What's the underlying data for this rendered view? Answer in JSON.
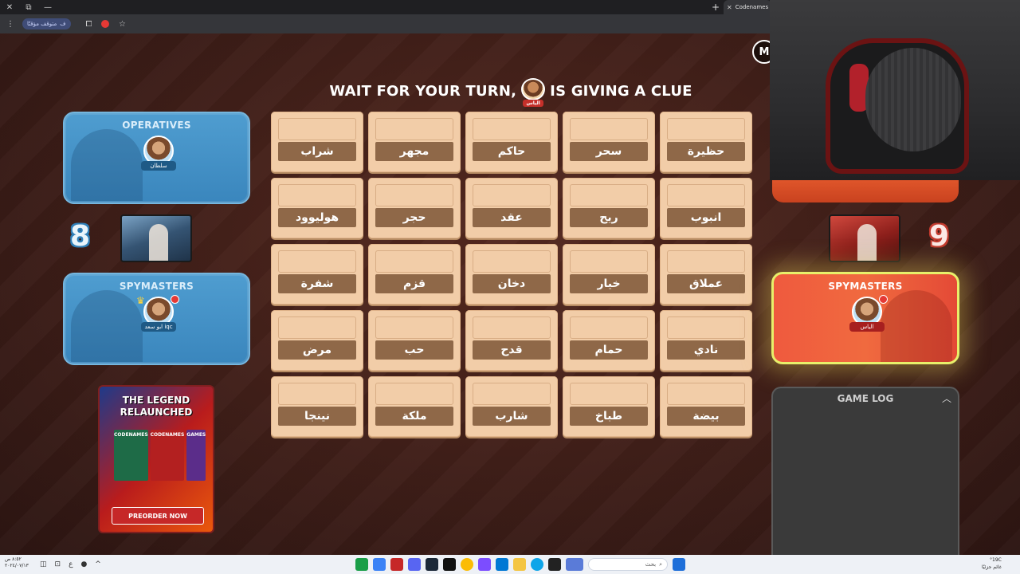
{
  "browser": {
    "tab_title": "Codenames Or",
    "paused_label": "متوقف مؤقتًا",
    "profile_initial": "ف",
    "new_tab_symbol": "+"
  },
  "game": {
    "menu_button_label": "M",
    "headline_before": "WAIT FOR YOUR TURN,",
    "headline_after": "IS GIVING A CLUE",
    "headline_avatar_name": "الياس",
    "blue": {
      "score": "8",
      "operatives_title": "OPERATIVES",
      "operatives_player": "سلطان",
      "spymasters_title": "SPYMASTERS",
      "spymaster_player": "ابو سعد iqc"
    },
    "red": {
      "score": "9",
      "spymasters_title": "SPYMASTERS",
      "spymaster_player": "الياس"
    },
    "game_log_title": "GAME LOG",
    "cards": [
      "شراب",
      "مجهر",
      "حاكم",
      "سحر",
      "حظيرة",
      "هوليوود",
      "حجر",
      "عقد",
      "ريح",
      "انبوب",
      "شفرة",
      "قزم",
      "دخان",
      "خيار",
      "عملاق",
      "مرض",
      "حب",
      "قدح",
      "حمام",
      "نادي",
      "نينجا",
      "ملكة",
      "شارب",
      "طباخ",
      "بيضة"
    ],
    "ad": {
      "title_line1": "THE LEGEND",
      "title_line2": "RELAUNCHED",
      "box_labels": [
        "CODENAMES",
        "CODENAMES",
        "GAMES"
      ],
      "button_label": "PREORDER NOW"
    }
  },
  "taskbar": {
    "search_placeholder": "بحث",
    "clock_time": "٨:٥٢ ص",
    "clock_date": "٢٠٢٤/٠٧/١٣",
    "weather_temp": "°19C",
    "weather_text": "غائم جزئيًا"
  },
  "colors": {
    "blue_team": "#3a86bd",
    "red_team": "#ef5a3e",
    "card": "#f2cda8",
    "card_word_strip": "#8f6848",
    "highlight": "#e8f06a"
  },
  "icons": [
    "close-icon",
    "minimize-icon",
    "restore-icon",
    "extensions-icon",
    "star-icon",
    "crown-icon",
    "wifi-icon",
    "chevron-up-icon",
    "search-icon"
  ]
}
